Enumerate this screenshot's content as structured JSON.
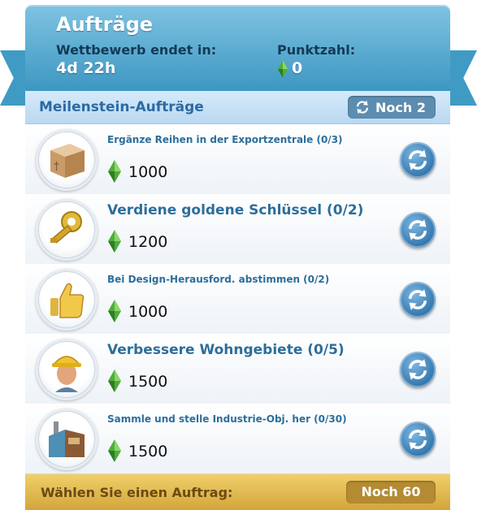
{
  "header": {
    "title": "Aufträge",
    "competition_label": "Wettbewerb endet in:",
    "competition_value": "4d 22h",
    "score_label": "Punktzahl:",
    "score_value": "0"
  },
  "milestones": {
    "title": "Meilenstein-Aufträge",
    "remaining": "Noch 2"
  },
  "tasks": [
    {
      "title": "Ergänze Reihen in der Exportzentrale (0/3)",
      "reward": "1000",
      "icon": "crate-icon"
    },
    {
      "title": "Verdiene goldene Schlüssel (0/2)",
      "reward": "1200",
      "icon": "golden-key-icon"
    },
    {
      "title": "Bei Design-Herausford. abstimmen (0/2)",
      "reward": "1000",
      "icon": "thumbs-up-icon"
    },
    {
      "title": "Verbessere Wohngebiete (0/5)",
      "reward": "1500",
      "icon": "worker-icon"
    },
    {
      "title": "Sammle und stelle Industrie-Obj. her (0/30)",
      "reward": "1500",
      "icon": "factory-icon"
    }
  ],
  "footer": {
    "prompt": "Wählen Sie einen Auftrag:",
    "remaining": "Noch 60"
  },
  "colors": {
    "header_blue": "#3d97c2",
    "title_text": "#2d6e9a",
    "footer_gold": "#d3a53b",
    "simoleon_green": "#4caf3b"
  }
}
